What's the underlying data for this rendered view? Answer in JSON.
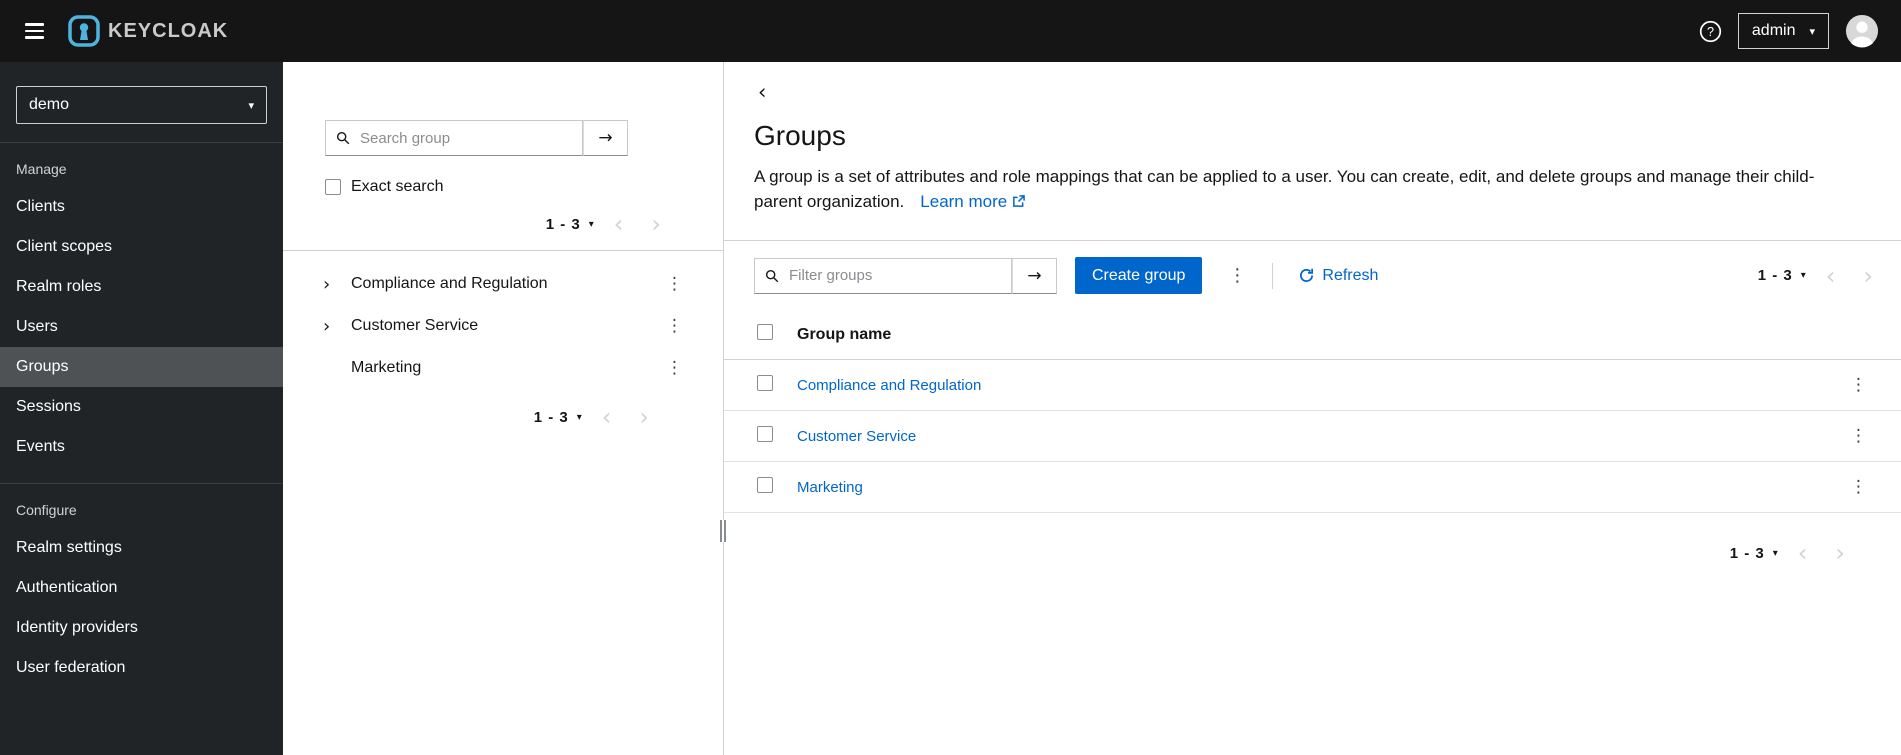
{
  "masthead": {
    "brand": "KEYCLOAK",
    "username": "admin"
  },
  "sidebar": {
    "realm": "demo",
    "sections": [
      {
        "label": "Manage",
        "items": [
          {
            "label": "Clients",
            "active": false
          },
          {
            "label": "Client scopes",
            "active": false
          },
          {
            "label": "Realm roles",
            "active": false
          },
          {
            "label": "Users",
            "active": false
          },
          {
            "label": "Groups",
            "active": true
          },
          {
            "label": "Sessions",
            "active": false
          },
          {
            "label": "Events",
            "active": false
          }
        ]
      },
      {
        "label": "Configure",
        "items": [
          {
            "label": "Realm settings",
            "active": false
          },
          {
            "label": "Authentication",
            "active": false
          },
          {
            "label": "Identity providers",
            "active": false
          },
          {
            "label": "User federation",
            "active": false
          }
        ]
      }
    ]
  },
  "tree_panel": {
    "search_placeholder": "Search group",
    "exact_search_label": "Exact search",
    "pagination_range": "1 - 3",
    "items": [
      {
        "label": "Compliance and Regulation",
        "expandable": true
      },
      {
        "label": "Customer Service",
        "expandable": true
      },
      {
        "label": "Marketing",
        "expandable": false
      }
    ]
  },
  "main": {
    "title": "Groups",
    "description": "A group is a set of attributes and role mappings that can be applied to a user. You can create, edit, and delete groups and manage their child-parent organization.",
    "learn_more_label": "Learn more",
    "filter_placeholder": "Filter groups",
    "create_button_label": "Create group",
    "refresh_label": "Refresh",
    "pagination_range": "1 - 3",
    "table": {
      "name_column": "Group name",
      "rows": [
        {
          "name": "Compliance and Regulation"
        },
        {
          "name": "Customer Service"
        },
        {
          "name": "Marketing"
        }
      ]
    }
  },
  "icons": {
    "caret_down": "▾",
    "chevron_left": "‹",
    "chevron_right": "›",
    "arrow_right": "→",
    "kebab": "⋮",
    "back": "‹",
    "expand": "›",
    "question": "?"
  },
  "colors": {
    "primary": "#0066cc",
    "link": "#0066cc",
    "masthead_bg": "#151515",
    "sidebar_bg": "#212427",
    "sidebar_active_bg": "#4f5255",
    "border": "#d2d2d2"
  }
}
